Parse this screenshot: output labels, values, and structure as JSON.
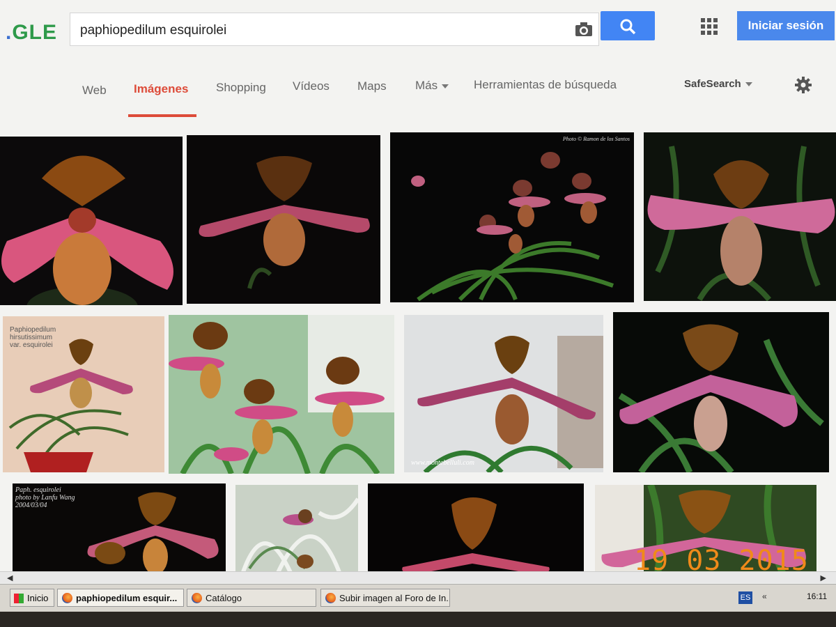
{
  "header": {
    "logo_text": "GLE",
    "search_query": "paphiopedilum esquirolei",
    "camera_icon": "camera-icon",
    "search_button_icon": "magnifier-icon",
    "apps_icon": "apps-grid-icon",
    "signin_label": "Iniciar sesión"
  },
  "tabs": [
    {
      "label": "Web"
    },
    {
      "label": "Imágenes"
    },
    {
      "label": "Shopping"
    },
    {
      "label": "Vídeos"
    },
    {
      "label": "Maps"
    },
    {
      "label": "Más"
    },
    {
      "label": "Herramientas de búsqueda"
    }
  ],
  "active_tab": "Imágenes",
  "safesearch_label": "SafeSearch",
  "accent_color": "#dd4b39",
  "button_color": "#4285f4",
  "images": [
    {
      "caption": ""
    },
    {
      "caption": ""
    },
    {
      "caption": "Photo © Ramon de los Santos"
    },
    {
      "caption": ""
    },
    {
      "caption": "Paphiopedilum hirsutissimum var. esquirolei"
    },
    {
      "caption": ""
    },
    {
      "caption": "www.montebelluli.com"
    },
    {
      "caption": ""
    },
    {
      "caption": "Paph. esquirolei photo by Lanfu Wang 2004/03/04"
    },
    {
      "caption": ""
    },
    {
      "caption": ""
    },
    {
      "caption": ""
    }
  ],
  "photo_date_stamp": "19 03 2015",
  "taskbar": {
    "start_label": "Inicio",
    "tasks": [
      {
        "label": "paphiopedilum esquir..."
      },
      {
        "label": "Catálogo"
      },
      {
        "label": "Subir imagen al Foro de In..."
      }
    ],
    "language": "ES",
    "clock": "16:11"
  }
}
